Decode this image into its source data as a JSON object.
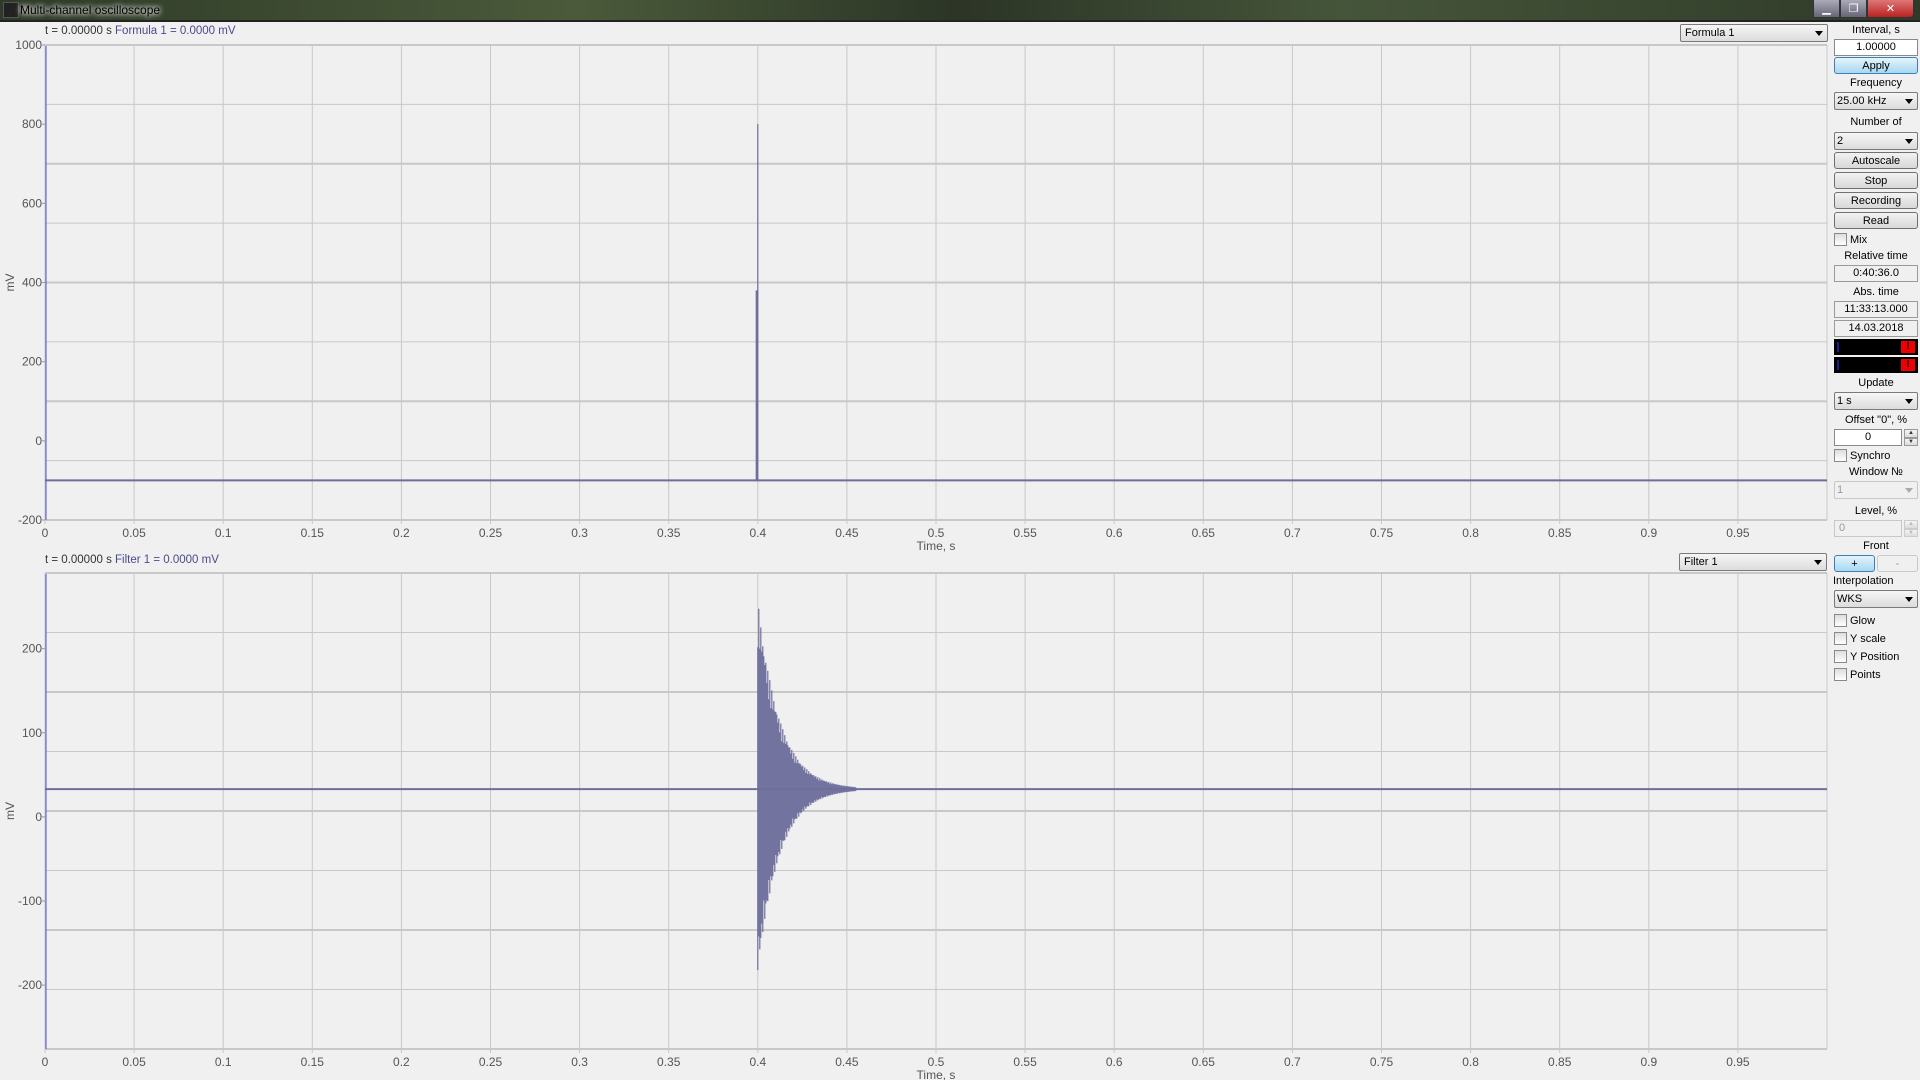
{
  "window": {
    "title": "Multi-channel oscilloscope",
    "buttons": {
      "minimize": "▁",
      "maximize": "❐",
      "close": "✕"
    }
  },
  "colors": {
    "trace": "#6e6e9c",
    "grid": "#c8c8c8",
    "cursor": "#5050d0",
    "alarm": "#e00000"
  },
  "plots": [
    {
      "header": {
        "time_label": "t = 0.00000 s",
        "channel_label": "Formula 1 =  0.0000 mV"
      },
      "channel_select": "Formula 1"
    },
    {
      "header": {
        "time_label": "t = 0.00000 s",
        "channel_label": "Filter 1 =  0.0000 mV"
      },
      "channel_select": "Filter 1"
    }
  ],
  "chart_data": [
    {
      "type": "line",
      "title": "Formula 1",
      "xlabel": "Time, s",
      "ylabel": "mV",
      "xlim": [
        0,
        1.0
      ],
      "ylim": [
        -200,
        1000
      ],
      "x_ticks": [
        "0",
        "0.05",
        "0.1",
        "0.15",
        "0.2",
        "0.25",
        "0.3",
        "0.35",
        "0.4",
        "0.45",
        "0.5",
        "0.55",
        "0.6",
        "0.65",
        "0.7",
        "0.75",
        "0.8",
        "0.85",
        "0.9",
        "0.95"
      ],
      "y_ticks": [
        "1000",
        "800",
        "600",
        "400",
        "200",
        "0",
        "-200"
      ],
      "grid": true,
      "series": [
        {
          "name": "Formula 1",
          "baseline": -100,
          "impulses": [
            {
              "x": 0.4,
              "y": 800
            },
            {
              "x": 0.3995,
              "y": 380
            }
          ]
        }
      ]
    },
    {
      "type": "line",
      "title": "Filter 1",
      "xlabel": "Time, s",
      "ylabel": "mV",
      "xlim": [
        0,
        1.0
      ],
      "ylim": [
        -276,
        290
      ],
      "x_ticks": [
        "0",
        "0.05",
        "0.1",
        "0.15",
        "0.2",
        "0.25",
        "0.3",
        "0.35",
        "0.4",
        "0.45",
        "0.5",
        "0.55",
        "0.6",
        "0.65",
        "0.7",
        "0.75",
        "0.8",
        "0.85",
        "0.9",
        "0.95"
      ],
      "y_ticks": [
        "200",
        "100",
        "0",
        "-100",
        "-200"
      ],
      "grid": true,
      "series": [
        {
          "name": "Filter 1",
          "baseline": 33,
          "decaying_oscillation": {
            "start": 0.4,
            "end": 0.455,
            "peak_max": 258,
            "peak_min": -182
          }
        }
      ]
    }
  ],
  "panel": {
    "interval_label": "Interval, s",
    "interval_value": "1.00000",
    "apply": "Apply",
    "frequency_label": "Frequency",
    "frequency_value": "25.00 kHz",
    "number_label": "Number of",
    "number_value": "2",
    "autoscale": "Autoscale",
    "stop": "Stop",
    "recording": "Recording",
    "read": "Read",
    "mix": "Mix",
    "relative_time_label": "Relative time",
    "relative_time": "0:40:36.0",
    "abs_time_label": "Abs. time",
    "abs_time": "11:33:13.000",
    "abs_date": "14.03.2018",
    "alarm_glyph": "!",
    "update_label": "Update",
    "update_value": "1 s",
    "offset_label": "Offset \"0\", %",
    "offset_value": "0",
    "synchro": "Synchro",
    "window_label": "Window №",
    "window_value": "1",
    "level_label": "Level, %",
    "level_value": "0",
    "front_label": "Front",
    "front_plus": "+",
    "front_minus": "-",
    "interpolation_label": "Interpolation",
    "interpolation_value": "WKS",
    "glow": "Glow",
    "y_scale": "Y scale",
    "y_position": "Y Position",
    "points": "Points"
  }
}
